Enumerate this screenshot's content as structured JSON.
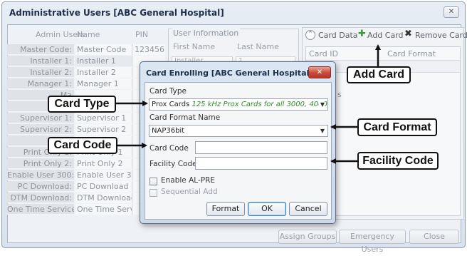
{
  "window": {
    "title": "Administrative Users [ABC General Hospital]",
    "close_label": "✕"
  },
  "users_table": {
    "headers": [
      "Admin Users",
      "Name",
      "PIN"
    ],
    "rows": [
      {
        "label": "Master Code:",
        "name": "Master Code",
        "pin": "123456"
      },
      {
        "label": "Installer 1:",
        "name": "Installer 1",
        "pin": ""
      },
      {
        "label": "Installer 2:",
        "name": "Installer 2",
        "pin": ""
      },
      {
        "label": "Manager 1:",
        "name": "Manager 1",
        "pin": ""
      },
      {
        "label": "Ma",
        "name": "",
        "pin": ""
      },
      {
        "label": "Ma",
        "name": "",
        "pin": ""
      },
      {
        "label": "Supervisor 1:",
        "name": "Supervisor 1",
        "pin": ""
      },
      {
        "label": "Supervisor 2:",
        "name": "Supervisor 2",
        "pin": ""
      },
      {
        "label": "Supe",
        "name": "",
        "pin": ""
      },
      {
        "label": "Print Only 1:",
        "name": "Print Only 1",
        "pin": ""
      },
      {
        "label": "Print Only 2:",
        "name": "Print Only 2",
        "pin": ""
      },
      {
        "label": "Enable User 300:",
        "name": "Enable User 300",
        "pin": ""
      },
      {
        "label": "PC Download:",
        "name": "PC Download",
        "pin": ""
      },
      {
        "label": "DTM Download:",
        "name": "DTM Download",
        "pin": ""
      },
      {
        "label": "One Time Service:",
        "name": "One Time Servic",
        "pin": ""
      }
    ]
  },
  "user_info": {
    "legend": "User Information",
    "first_name_label": "First Name",
    "last_name_label": "Last Name",
    "first_name_value": "Installer",
    "last_name_value": "1"
  },
  "card_data": {
    "title": "Card Data",
    "add_label": "Add Card",
    "remove_label": "Remove Card",
    "col_card_id": "Card ID",
    "col_card_format": "Card Format Name",
    "partial_text": "s"
  },
  "bottom_buttons": {
    "assign_groups": "Assign Groups",
    "emergency_users": "Emergency Users",
    "close": "Close"
  },
  "dialog": {
    "title": "Card Enrolling [ABC General Hospital]",
    "close_label": "✕",
    "card_type_label": "Card Type",
    "card_type_prefix": "Prox Cards",
    "card_type_value": "125 kHz Prox Cards for all 3000, 4000, 5",
    "card_format_label": "Card Format Name",
    "card_format_value": "NAP36bit",
    "card_code_label": "Card Code",
    "card_code_value": "",
    "facility_code_label": "Facility Code",
    "facility_code_value": "",
    "enable_al_pre_label": "Enable AL-PRE",
    "sequential_add_label": "Sequential Add",
    "format_button": "Format",
    "ok_button": "OK",
    "cancel_button": "Cancel"
  },
  "callouts": {
    "card_type": "Card Type",
    "card_code": "Card Code",
    "add_card": "Add Card",
    "card_format": "Card Format",
    "facility_code": "Facility Code"
  },
  "colors": {
    "accent": "#3c7fb1",
    "close_red": "#c9483a",
    "card_type_green": "#2e8b2e",
    "add_green": "#3a9a3a",
    "remove_dark": "#333333"
  },
  "icons": [
    "close-icon",
    "collapse-up-icon",
    "add-plus-icon",
    "remove-x-icon",
    "dropdown-arrow-icon",
    "checkbox-icon"
  ]
}
